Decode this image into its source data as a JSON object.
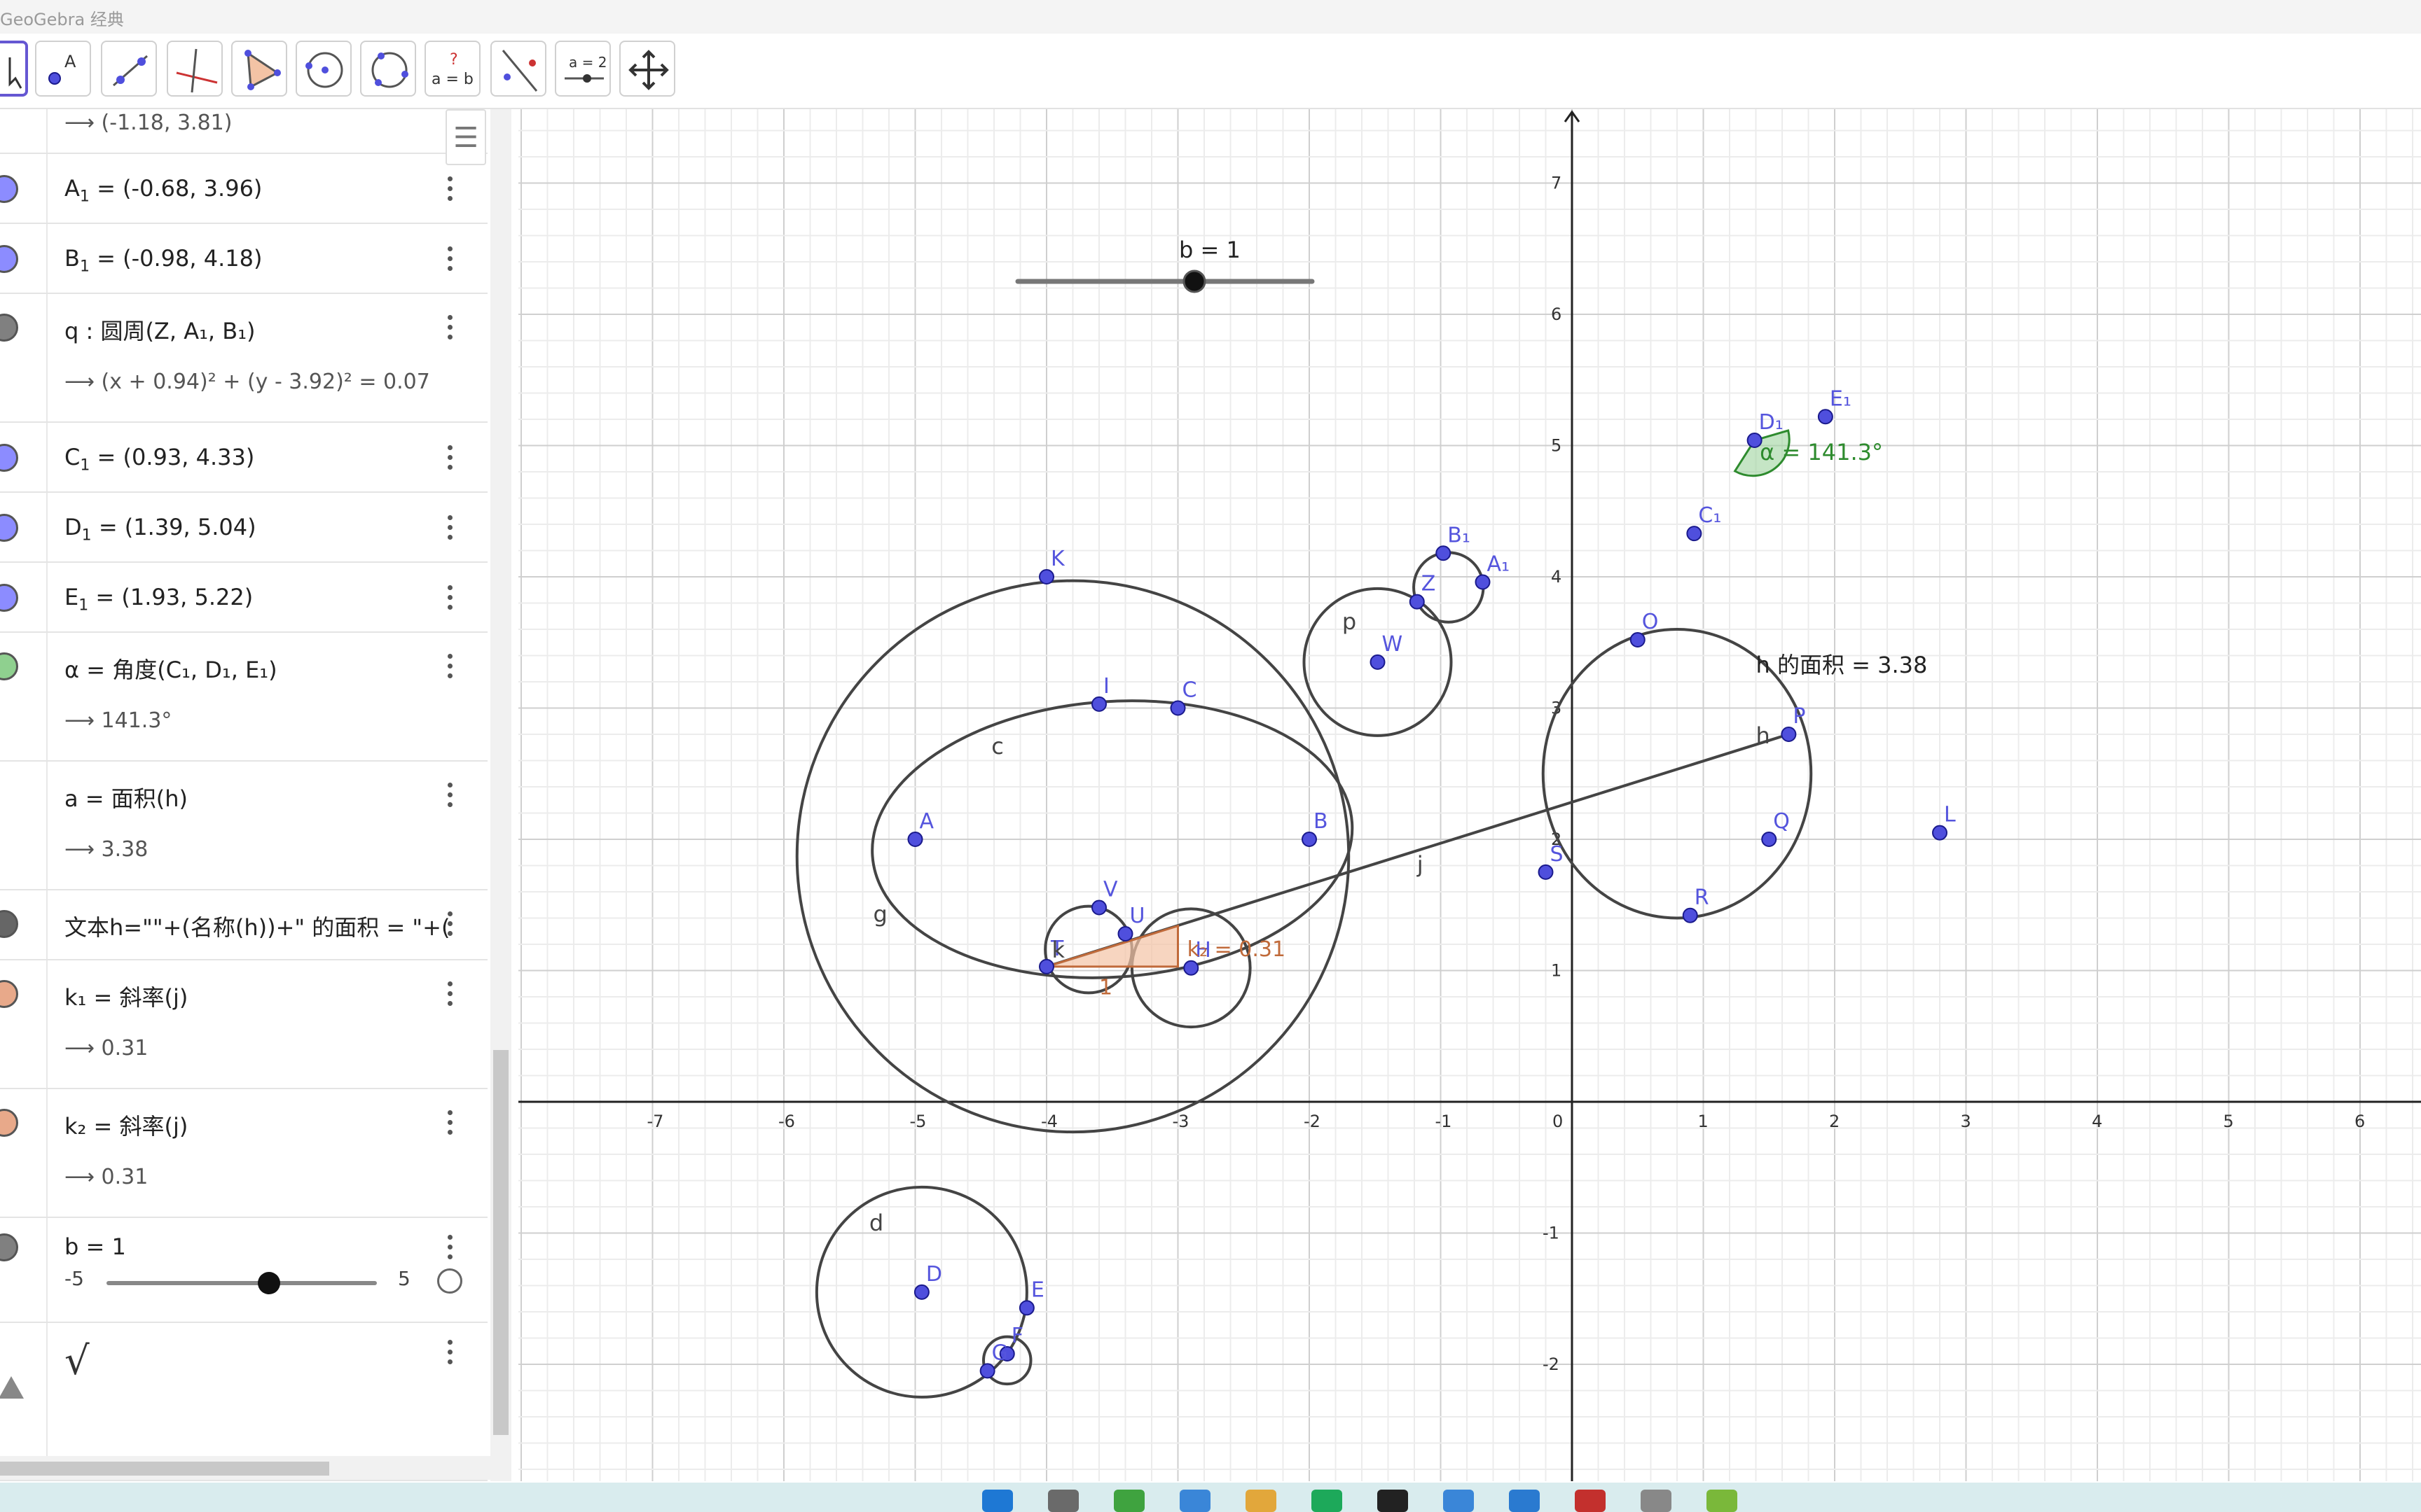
{
  "window": {
    "title": "GeoGebra 经典"
  },
  "toolbar": {
    "tools": [
      {
        "name": "move-tool",
        "label": ""
      },
      {
        "name": "point-tool",
        "label": "A"
      },
      {
        "name": "line-tool",
        "label": ""
      },
      {
        "name": "perpendicular-tool",
        "label": ""
      },
      {
        "name": "polygon-tool",
        "label": ""
      },
      {
        "name": "circle-center-point-tool",
        "label": ""
      },
      {
        "name": "circle-three-points-tool",
        "label": ""
      },
      {
        "name": "relation-tool",
        "label_top": "?",
        "label_bottom": "a = b"
      },
      {
        "name": "reflect-tool",
        "label": ""
      },
      {
        "name": "slider-tool",
        "label": "a = 2"
      },
      {
        "name": "move-view-tool",
        "label": ""
      }
    ]
  },
  "algebra": {
    "style_button": "☰",
    "rows": [
      {
        "output": "⟶  (-1.18, 3.81)"
      },
      {
        "color": "#8c8cff",
        "label": "A",
        "sub": "1",
        "def": " = (-0.68, 3.96)"
      },
      {
        "color": "#8c8cff",
        "label": "B",
        "sub": "1",
        "def": " = (-0.98, 4.18)"
      },
      {
        "color": "#808080",
        "def_text": "q : 圆周(Z, A₁, B₁)",
        "output": "⟶  (x + 0.94)² + (y - 3.92)² = 0.07"
      },
      {
        "color": "#8c8cff",
        "label": "C",
        "sub": "1",
        "def": " = (0.93, 4.33)"
      },
      {
        "color": "#8c8cff",
        "label": "D",
        "sub": "1",
        "def": " = (1.39, 5.04)"
      },
      {
        "color": "#8c8cff",
        "label": "E",
        "sub": "1",
        "def": " = (1.93, 5.22)"
      },
      {
        "color": "#8fd08f",
        "def_text": "α  =  角度(C₁, D₁, E₁)",
        "output": "⟶  141.3°"
      },
      {
        "color": "",
        "def_text": "a  =  面积(h)",
        "output": "⟶  3.38"
      },
      {
        "color": "#666666",
        "def_text": "文本h=\"\"+(名称(h))+\" 的面积 = \"+("
      },
      {
        "color": "#e8a98a",
        "def_text": "k₁  =  斜率(j)",
        "output": "⟶  0.31"
      },
      {
        "color": "#e8a98a",
        "def_text": "k₂  =  斜率(j)",
        "output": "⟶  0.31"
      },
      {
        "color": "#808080",
        "def_text": "b = 1",
        "slider_min": "-5",
        "slider_max": "5",
        "slider_value": 1
      },
      {
        "color": "",
        "def_text": "√"
      }
    ]
  },
  "graphics": {
    "x_ticks": [
      "-7",
      "-6",
      "-5",
      "-4",
      "-3",
      "-2",
      "-1",
      "0",
      "1",
      "2",
      "3",
      "4",
      "5",
      "6"
    ],
    "y_ticks": [
      "7",
      "6",
      "5",
      "4",
      "3",
      "2",
      "1",
      "-1",
      "-2"
    ],
    "slider": {
      "label": "b = 1",
      "value": 1,
      "min": -5,
      "max": 5
    },
    "points": [
      {
        "name": "A",
        "x": -5.0,
        "y": 2.0
      },
      {
        "name": "B",
        "x": -2.0,
        "y": 2.0
      },
      {
        "name": "C",
        "x": -3.0,
        "y": 3.0
      },
      {
        "name": "I",
        "x": -3.6,
        "y": 3.03
      },
      {
        "name": "K",
        "x": -4.0,
        "y": 4.0
      },
      {
        "name": "V",
        "x": -3.6,
        "y": 1.48
      },
      {
        "name": "U",
        "x": -3.4,
        "y": 1.28
      },
      {
        "name": "T",
        "x": -4.0,
        "y": 1.03
      },
      {
        "name": "H",
        "x": -2.9,
        "y": 1.02
      },
      {
        "name": "W",
        "x": -1.48,
        "y": 3.35
      },
      {
        "name": "Z",
        "x": -1.18,
        "y": 3.81
      },
      {
        "name": "A₁",
        "x": -0.68,
        "y": 3.96
      },
      {
        "name": "B₁",
        "x": -0.98,
        "y": 4.18
      },
      {
        "name": "O",
        "x": 0.5,
        "y": 3.52
      },
      {
        "name": "P",
        "x": 1.65,
        "y": 2.8
      },
      {
        "name": "Q",
        "x": 1.5,
        "y": 2.0
      },
      {
        "name": "R",
        "x": 0.9,
        "y": 1.42
      },
      {
        "name": "S",
        "x": -0.2,
        "y": 1.75
      },
      {
        "name": "L",
        "x": 2.8,
        "y": 2.05
      },
      {
        "name": "C₁",
        "x": 0.93,
        "y": 4.33
      },
      {
        "name": "D₁",
        "x": 1.39,
        "y": 5.04
      },
      {
        "name": "E₁",
        "x": 1.93,
        "y": 5.22
      },
      {
        "name": "D",
        "x": -4.95,
        "y": -1.45
      },
      {
        "name": "E",
        "x": -4.15,
        "y": -1.57
      },
      {
        "name": "F",
        "x": -4.3,
        "y": -1.92
      },
      {
        "name": "G",
        "x": -4.45,
        "y": -2.05
      }
    ],
    "labels": {
      "c": "c",
      "g": "g",
      "d": "d",
      "p": "p",
      "h": "h",
      "j": "j",
      "k": "k",
      "area_text": "h 的面积 = 3.38",
      "angle_text": "α = 141.3°",
      "slope_text": "k₂ = 0.31",
      "slope_run": "1"
    }
  },
  "colors": {
    "point": "#4f4fdd",
    "point_stroke": "#1a1a8c",
    "curve": "#444444",
    "angle": "#2e8b2e",
    "slope": "#c06a3a",
    "grid_minor": "#ececec",
    "grid_major": "#cfcfcf"
  }
}
